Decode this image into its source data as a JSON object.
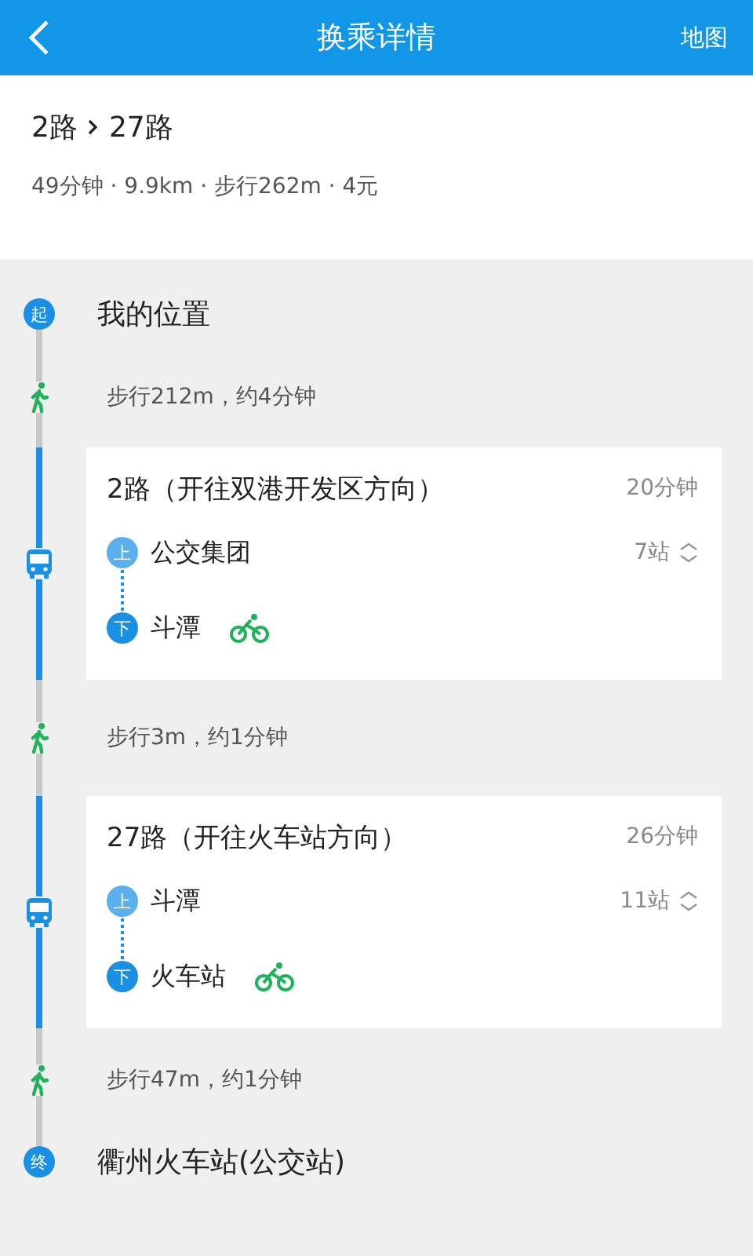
{
  "header": {
    "title": "换乘详情",
    "action": "地图"
  },
  "summary": {
    "lines": [
      "2路",
      "27路"
    ],
    "meta": "49分钟 · 9.9km · 步行262m · 4元"
  },
  "steps": [
    {
      "kind": "endpoint",
      "badge": "起",
      "name": "我的位置"
    },
    {
      "kind": "walk",
      "text": "步行212m，约4分钟"
    },
    {
      "kind": "bus",
      "title": "2路（开往双港开发区方向）",
      "duration": "20分钟",
      "board": {
        "badge": "上",
        "name": "公交集团"
      },
      "stops": "7站",
      "alight": {
        "badge": "下",
        "name": "斗潭"
      }
    },
    {
      "kind": "walk",
      "text": "步行3m，约1分钟"
    },
    {
      "kind": "bus",
      "title": "27路（开往火车站方向）",
      "duration": "26分钟",
      "board": {
        "badge": "上",
        "name": "斗潭"
      },
      "stops": "11站",
      "alight": {
        "badge": "下",
        "name": "火车站"
      }
    },
    {
      "kind": "walk",
      "text": "步行47m，约1分钟"
    },
    {
      "kind": "endpoint",
      "badge": "终",
      "name": "衢州火车站(公交站)"
    }
  ]
}
